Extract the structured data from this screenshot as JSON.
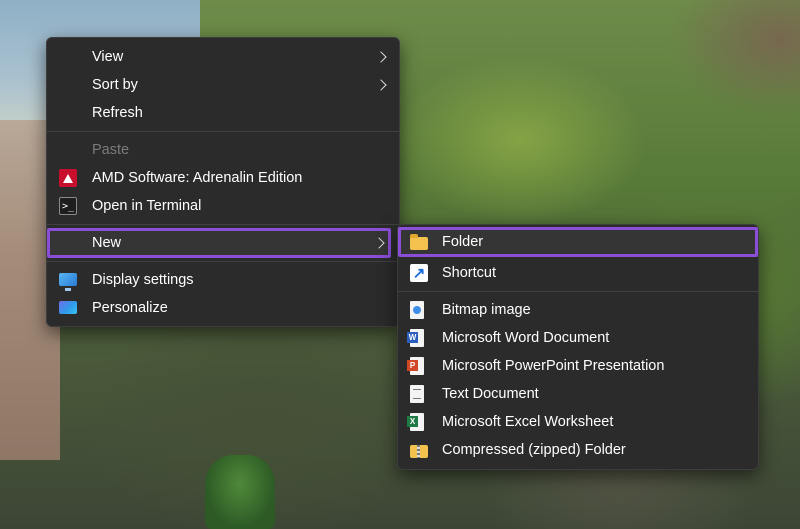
{
  "context_menu": {
    "items": [
      {
        "label": "View",
        "has_submenu": true
      },
      {
        "label": "Sort by",
        "has_submenu": true
      },
      {
        "label": "Refresh"
      },
      {
        "label": "Paste",
        "disabled": true
      },
      {
        "label": "AMD Software: Adrenalin Edition",
        "icon": "amd-icon"
      },
      {
        "label": "Open in Terminal",
        "icon": "terminal-icon"
      },
      {
        "label": "New",
        "has_submenu": true,
        "highlighted": true
      },
      {
        "label": "Display settings",
        "icon": "display-icon"
      },
      {
        "label": "Personalize",
        "icon": "personalize-icon"
      }
    ]
  },
  "new_submenu": {
    "items": [
      {
        "label": "Folder",
        "icon": "folder-icon",
        "highlighted": true
      },
      {
        "label": "Shortcut",
        "icon": "shortcut-icon"
      },
      {
        "label": "Bitmap image",
        "icon": "bitmap-icon"
      },
      {
        "label": "Microsoft Word Document",
        "icon": "word-icon"
      },
      {
        "label": "Microsoft PowerPoint Presentation",
        "icon": "powerpoint-icon"
      },
      {
        "label": "Text Document",
        "icon": "text-document-icon"
      },
      {
        "label": "Microsoft Excel Worksheet",
        "icon": "excel-icon"
      },
      {
        "label": "Compressed (zipped) Folder",
        "icon": "zip-folder-icon"
      }
    ]
  },
  "colors": {
    "menu_background": "#2b2b2b",
    "highlight_outline": "#8a4fd6",
    "text": "#ffffff",
    "disabled_text": "#7a7a7a"
  }
}
